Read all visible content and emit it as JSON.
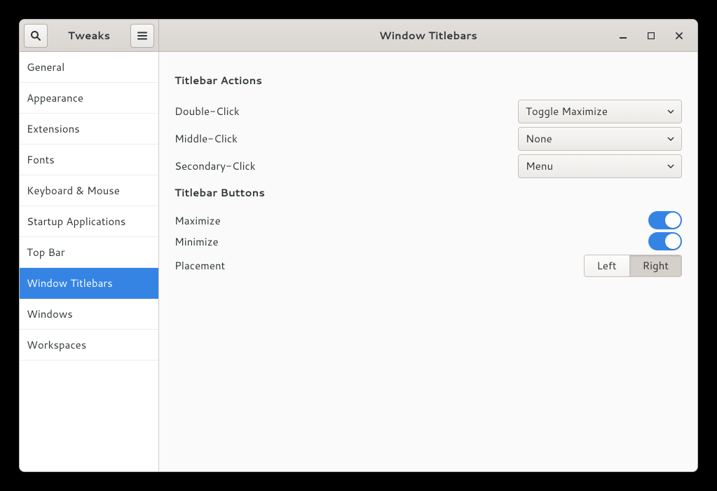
{
  "header": {
    "app_title": "Tweaks",
    "page_title": "Window Titlebars"
  },
  "sidebar": {
    "items": [
      "General",
      "Appearance",
      "Extensions",
      "Fonts",
      "Keyboard & Mouse",
      "Startup Applications",
      "Top Bar",
      "Window Titlebars",
      "Windows",
      "Workspaces"
    ],
    "selected_index": 7
  },
  "sections": {
    "titlebar_actions": {
      "title": "Titlebar Actions",
      "rows": {
        "double_click": {
          "label": "Double-Click",
          "value": "Toggle Maximize"
        },
        "middle_click": {
          "label": "Middle-Click",
          "value": "None"
        },
        "secondary_click": {
          "label": "Secondary-Click",
          "value": "Menu"
        }
      }
    },
    "titlebar_buttons": {
      "title": "Titlebar Buttons",
      "rows": {
        "maximize": {
          "label": "Maximize",
          "value": true
        },
        "minimize": {
          "label": "Minimize",
          "value": true
        },
        "placement": {
          "label": "Placement",
          "options": [
            "Left",
            "Right"
          ],
          "selected": "Right"
        }
      }
    }
  }
}
